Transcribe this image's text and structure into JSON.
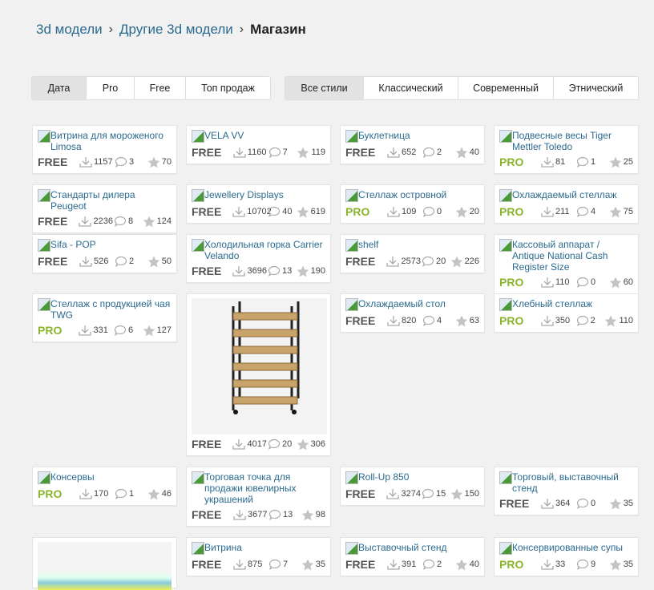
{
  "breadcrumb": [
    "3d модели",
    "Другие 3d модели",
    "Магазин"
  ],
  "sort_tabs": [
    "Дата",
    "Pro",
    "Free",
    "Топ продаж"
  ],
  "style_tabs": [
    "Все стили",
    "Классический",
    "Современный",
    "Этнический"
  ],
  "columns": [
    [
      {
        "title": "Витрина для мороженого Limosa",
        "license": "FREE",
        "downloads": "1157",
        "comments": "3",
        "rating": "70"
      },
      {
        "title": "Стандарты дилера Peugeot",
        "license": "FREE",
        "downloads": "2236",
        "comments": "8",
        "rating": "124"
      },
      {
        "title": "Sifa - POP",
        "license": "FREE",
        "downloads": "526",
        "comments": "2",
        "rating": "50"
      },
      {
        "title": "Стеллаж с продукцией чая TWG",
        "license": "PRO",
        "downloads": "331",
        "comments": "6",
        "rating": "127"
      },
      {
        "title": "Консервы",
        "license": "PRO",
        "downloads": "170",
        "comments": "1",
        "rating": "46"
      }
    ],
    [
      {
        "title": "VELA VV",
        "license": "FREE",
        "downloads": "1160",
        "comments": "7",
        "rating": "119"
      },
      {
        "title": "Jewellery Displays",
        "license": "FREE",
        "downloads": "10702",
        "comments": "40",
        "rating": "619"
      },
      {
        "title": "Холодильная горка Carrier Velando",
        "license": "FREE",
        "downloads": "3696",
        "comments": "13",
        "rating": "190"
      },
      {
        "title": "",
        "license": "FREE",
        "downloads": "4017",
        "comments": "20",
        "rating": "306",
        "image": true
      },
      {
        "title": "Торговая точка для продажи ювелирных украшений",
        "license": "FREE",
        "downloads": "3677",
        "comments": "13",
        "rating": "98"
      },
      {
        "title": "Витрина",
        "license": "FREE",
        "downloads": "875",
        "comments": "7",
        "rating": "35"
      }
    ],
    [
      {
        "title": "Буклетница",
        "license": "FREE",
        "downloads": "652",
        "comments": "2",
        "rating": "40"
      },
      {
        "title": "Стеллаж островной",
        "license": "PRO",
        "downloads": "109",
        "comments": "0",
        "rating": "20"
      },
      {
        "title": "shelf",
        "license": "FREE",
        "downloads": "2573",
        "comments": "20",
        "rating": "226"
      },
      {
        "title": "Охлаждаемый стол",
        "license": "FREE",
        "downloads": "820",
        "comments": "4",
        "rating": "63"
      },
      {
        "title": "Roll-Up 850",
        "license": "FREE",
        "downloads": "3274",
        "comments": "15",
        "rating": "150"
      },
      {
        "title": "Выставочный стенд",
        "license": "FREE",
        "downloads": "391",
        "comments": "2",
        "rating": "40"
      }
    ],
    [
      {
        "title": "Подвесные весы Tiger Mettler Toledo",
        "license": "PRO",
        "downloads": "81",
        "comments": "1",
        "rating": "25"
      },
      {
        "title": "Охлаждаемый стеллаж",
        "license": "PRO",
        "downloads": "211",
        "comments": "4",
        "rating": "75"
      },
      {
        "title": "Кассовый аппарат / Antique National Cash Register Size",
        "license": "PRO",
        "downloads": "110",
        "comments": "0",
        "rating": "60"
      },
      {
        "title": "Хлебный стеллаж",
        "license": "PRO",
        "downloads": "350",
        "comments": "2",
        "rating": "110"
      },
      {
        "title": "Торговый, выставочный стенд",
        "license": "FREE",
        "downloads": "364",
        "comments": "0",
        "rating": "35"
      },
      {
        "title": "Консервированные супы",
        "license": "PRO",
        "downloads": "33",
        "comments": "9",
        "rating": "35"
      }
    ]
  ],
  "colors": {
    "link": "#2a6a8f",
    "pro": "#8ab52a",
    "free": "#555555"
  }
}
